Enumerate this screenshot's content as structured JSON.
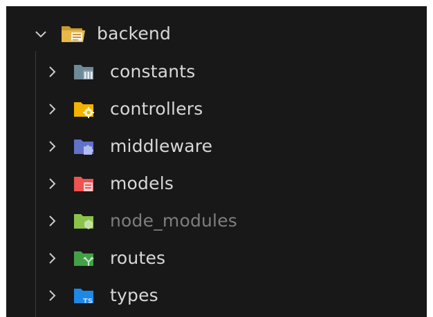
{
  "explorer": {
    "root": {
      "label": "backend",
      "icon": "folder-open-backend-icon",
      "expanded": true,
      "color": "#e8b84a"
    },
    "items": [
      {
        "label": "constants",
        "icon": "folder-constants-icon",
        "color": "#6e8a99",
        "dimmed": false
      },
      {
        "label": "controllers",
        "icon": "folder-controllers-icon",
        "color": "#f3b200",
        "dimmed": false
      },
      {
        "label": "middleware",
        "icon": "folder-middleware-icon",
        "color": "#6272c6",
        "dimmed": false
      },
      {
        "label": "models",
        "icon": "folder-models-icon",
        "color": "#ef5350",
        "dimmed": false
      },
      {
        "label": "node_modules",
        "icon": "folder-node-icon",
        "color": "#8bc34a",
        "dimmed": true
      },
      {
        "label": "routes",
        "icon": "folder-routes-icon",
        "color": "#43a047",
        "dimmed": false
      },
      {
        "label": "types",
        "icon": "folder-typescript-icon",
        "color": "#1e88e5",
        "dimmed": false
      }
    ]
  }
}
